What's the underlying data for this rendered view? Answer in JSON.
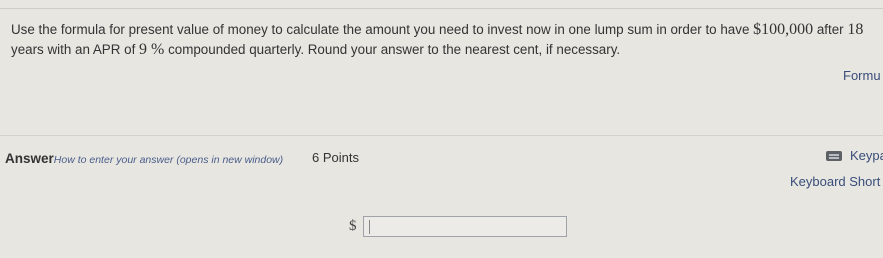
{
  "question": {
    "part1": "Use the formula for present value of money to calculate the amount you need to invest now in one lump sum in order to have ",
    "amount": "$100,000",
    "part2": " after ",
    "years": "18",
    "part3": " years with an APR of ",
    "apr": "9 %",
    "part4": " compounded quarterly. Round your answer to the nearest cent, if necessary."
  },
  "formula_link": "Formu",
  "answer": {
    "label": "Answer",
    "howto": "How to enter your answer (opens in new window)",
    "points": "6 Points",
    "currency": "$",
    "input_value": ""
  },
  "keypad_label": "Keypa",
  "keyboard_shortcuts_label": "Keyboard Short"
}
